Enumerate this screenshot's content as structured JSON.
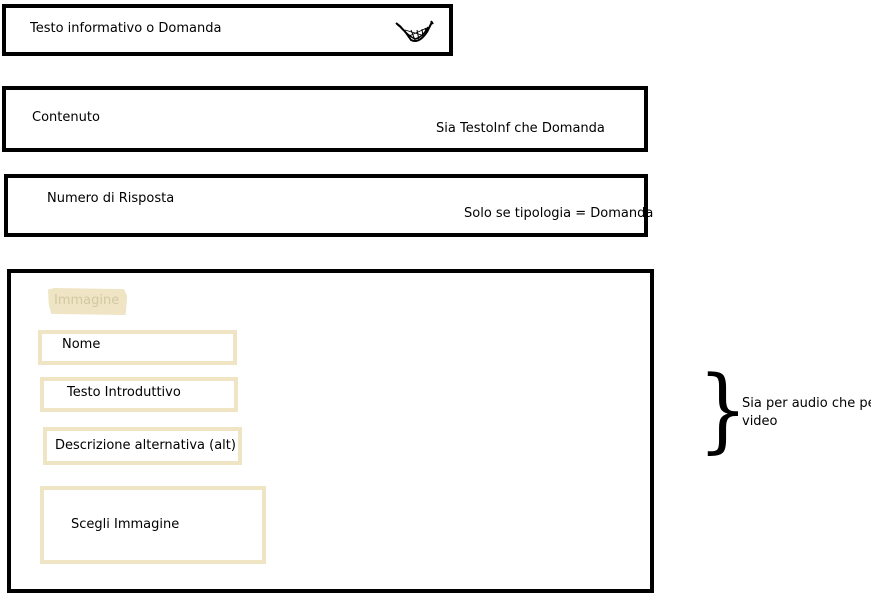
{
  "box1": {
    "title": "Testo informativo o Domanda",
    "icon": "hammock-icon"
  },
  "box2": {
    "label": "Contenuto",
    "note": "Sia TestoInf che Domanda"
  },
  "box3": {
    "label": "Numero di Risposta",
    "note": "Solo se tipologia = Domanda"
  },
  "box4": {
    "heading": "Immagine",
    "fields": {
      "nome": "Nome",
      "testo_introduttivo": "Testo Introduttivo",
      "descrizione_alt": "Descrizione alternativa (alt)",
      "scegli_immagine": "Scegli Immagine"
    }
  },
  "side": {
    "brace": "}",
    "note": "Sia per audio che per video"
  },
  "colors": {
    "border": "#000000",
    "field_border": "#efe4c3",
    "chip_bg": "#efe4c3",
    "chip_text": "#d2c8a6"
  }
}
